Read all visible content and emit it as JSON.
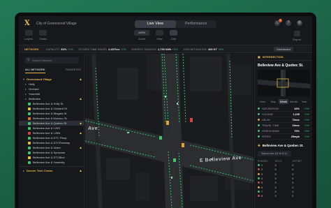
{
  "app": {
    "logo": "X",
    "city": "City of Greenwood Village",
    "view_tabs": [
      "Live View",
      "Performance"
    ],
    "active_tab": "Live View",
    "notification_count": "3"
  },
  "toolbar": {
    "tools": [
      "Layers",
      "Tasks"
    ],
    "zoom_value": "100%",
    "zoom_label": "Zoom",
    "view_label": "View",
    "grid_label": "Grid",
    "export_label": "Export"
  },
  "network_bar": {
    "label": "NETWORK",
    "metrics": [
      {
        "name": "CAPACITY",
        "value": "83%",
        "delta": "+1%"
      },
      {
        "name": "CITIZEN TIME SAVED",
        "value": "2,457hrs",
        "delta": "+2%"
      },
      {
        "name": "ENERGY SAVINGS",
        "value": "1,730 kWh",
        "delta": "+2%"
      },
      {
        "name": "GHG MITIGATION",
        "value": "425 KT",
        "delta": "+4%"
      }
    ],
    "dashboard_button": "Dashboard"
  },
  "sidebar": {
    "search_placeholder": "Search Network",
    "tabs": [
      "ALL NETWORK",
      "FAVORITES"
    ],
    "active_tab": "ALL NETWORK",
    "group": "Greenwood Village",
    "items": [
      {
        "label": "Holly",
        "level": "ok",
        "sub": false,
        "selected": false,
        "warn": false
      },
      {
        "label": "Orchard",
        "level": "ok",
        "sub": false,
        "selected": false,
        "warn": false
      },
      {
        "label": "Yosemite",
        "level": "ok",
        "sub": false,
        "selected": false,
        "warn": false
      },
      {
        "label": "Belleview",
        "level": "ok",
        "sub": false,
        "selected": false,
        "warn": true
      },
      {
        "label": "Belleview Ave & Holly St.",
        "level": "ok",
        "sub": true,
        "selected": false,
        "warn": false
      },
      {
        "label": "Belleview Ave & Orchard St.",
        "level": "y",
        "sub": true,
        "selected": false,
        "warn": false
      },
      {
        "label": "Belleview Ave & Niagara St.",
        "level": "ok",
        "sub": true,
        "selected": false,
        "warn": false
      },
      {
        "label": "Belleview Ave & Monaco St.",
        "level": "o",
        "sub": true,
        "selected": false,
        "warn": false
      },
      {
        "label": "Belleview Ave & Quebec St.",
        "level": "ok",
        "sub": true,
        "selected": true,
        "warn": true
      },
      {
        "label": "Belleview Ave & I-25S",
        "level": "ok",
        "sub": true,
        "selected": false,
        "warn": false
      },
      {
        "label": "Belleview Ave & I-25N",
        "level": "r",
        "sub": true,
        "selected": false,
        "warn": true
      },
      {
        "label": "Belleview Ave & DTC Pkwy",
        "level": "ok",
        "sub": true,
        "selected": false,
        "warn": false
      },
      {
        "label": "Belleview Ave & DTCParkway",
        "level": "y",
        "sub": true,
        "selected": false,
        "warn": false
      },
      {
        "label": "Belleview Ave & Ulster",
        "level": "ok",
        "sub": true,
        "selected": false,
        "warn": true
      },
      {
        "label": "Belleview Ave & Syracuse",
        "level": "ok",
        "sub": true,
        "selected": false,
        "warn": false
      },
      {
        "label": "Belleview Ave & DTCBlvd",
        "level": "y",
        "sub": true,
        "selected": false,
        "warn": false
      },
      {
        "label": "Belleview Ave & Yosemity",
        "level": "ok",
        "sub": true,
        "selected": false,
        "warn": false
      }
    ],
    "footer_group": "Denver Tech Center"
  },
  "map": {
    "street_west": "Ave",
    "street_east": "E Belleview Ave"
  },
  "right_panel": {
    "header": "INTERSECTION",
    "title": "Belleview Ave & Quebec St.",
    "period_tabs": [
      "Hour",
      "Day",
      "Week",
      "Month",
      "Year"
    ],
    "active_period": "Week",
    "metrics": [
      {
        "name": "SATURATION",
        "value": "42%",
        "delta": "+2%",
        "color": "g"
      },
      {
        "name": "VOLUME",
        "value": "1,245",
        "delta": "+1%",
        "color": "g"
      },
      {
        "name": "DELAY",
        "value": "73sec",
        "delta": "+2%",
        "color": "o"
      },
      {
        "name": "TRAVEL TIME",
        "value": "19sec",
        "delta": "+1%",
        "color": "g"
      },
      {
        "name": "GREEN BAND",
        "value": "70%",
        "delta": "+3%",
        "color": "g"
      },
      {
        "name": "SPEED",
        "value": "25mph",
        "delta": "+1%",
        "color": "g"
      }
    ],
    "subsection_title": "Belleview Ave & Quebec St.",
    "selector": "Signal plan (M-W 8-2)",
    "phase_headers": [
      "PHASES",
      "SPLIT",
      "OFFSET"
    ],
    "phases": [
      {
        "id": "1",
        "split": "0",
        "offset": "0",
        "color": "#3fc46d"
      },
      {
        "id": "2",
        "split": "0",
        "offset": "0",
        "color": "#d94545"
      },
      {
        "id": "3",
        "split": "0",
        "offset": "0",
        "color": "#e0a23a"
      },
      {
        "id": "4",
        "split": "0",
        "offset": "0",
        "color": "#3fc46d"
      },
      {
        "id": "5",
        "split": "0",
        "offset": "0",
        "color": "#d94545"
      },
      {
        "id": "6",
        "split": "0",
        "offset": "0",
        "color": "#e0a23a"
      },
      {
        "id": "7",
        "split": "0",
        "offset": "0",
        "color": "#3fc46d"
      },
      {
        "id": "8",
        "split": "0",
        "offset": "0",
        "color": "#d94545"
      }
    ]
  },
  "colors": {
    "accent": "#e6b84c",
    "ok": "#3fc46d",
    "warn": "#f2c12e",
    "alert": "#d94545",
    "orange": "#e0761f"
  }
}
